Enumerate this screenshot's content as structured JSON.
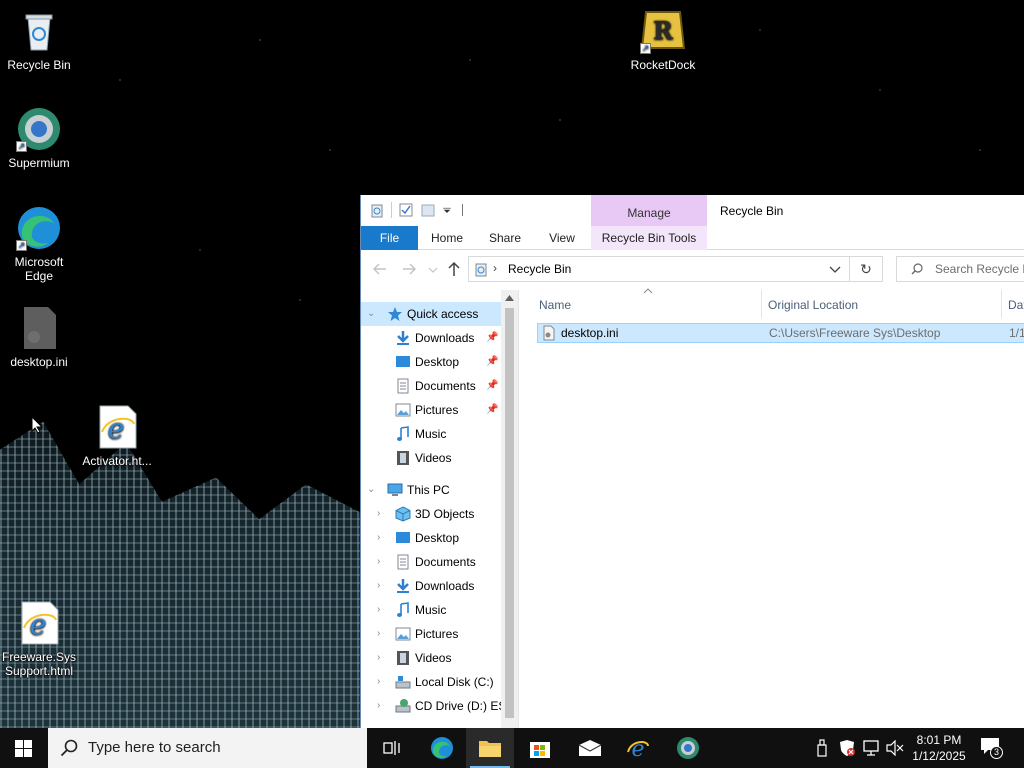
{
  "desktop": {
    "icons": [
      {
        "label": "Recycle Bin"
      },
      {
        "label": "RocketDock"
      },
      {
        "label": "Supermium"
      },
      {
        "label": "Microsoft Edge"
      },
      {
        "label": "desktop.ini"
      },
      {
        "label": "Activator.ht..."
      },
      {
        "label": "Freeware.Sys Support.html"
      }
    ]
  },
  "explorer": {
    "title": "Recycle Bin",
    "contextual_group": "Manage",
    "tabs": {
      "file": "File",
      "home": "Home",
      "share": "Share",
      "view": "View",
      "tools": "Recycle Bin Tools"
    },
    "address": {
      "path": "Recycle Bin",
      "separator": "›"
    },
    "search": {
      "placeholder": "Search Recycle Bin"
    },
    "nav": {
      "quick_access": "Quick access",
      "quick_items": [
        "Downloads",
        "Desktop",
        "Documents",
        "Pictures",
        "Music",
        "Videos"
      ],
      "this_pc": "This PC",
      "pc_items": [
        "3D Objects",
        "Desktop",
        "Documents",
        "Downloads",
        "Music",
        "Pictures",
        "Videos",
        "Local Disk (C:)",
        "CD Drive (D:) ESD"
      ]
    },
    "columns": {
      "name": "Name",
      "original_location": "Original Location",
      "date": "Dat"
    },
    "files": [
      {
        "name": "desktop.ini",
        "original_location": "C:\\Users\\Freeware Sys\\Desktop",
        "date": "1/1"
      }
    ]
  },
  "taskbar": {
    "search_placeholder": "Type here to search",
    "time": "8:01 PM",
    "date": "1/12/2025",
    "notification_count": "3"
  },
  "colors": {
    "file_tab": "#1979ca",
    "manage_tab": "#e8c8f5",
    "selection": "#cce8ff",
    "taskbar": "#101010"
  }
}
